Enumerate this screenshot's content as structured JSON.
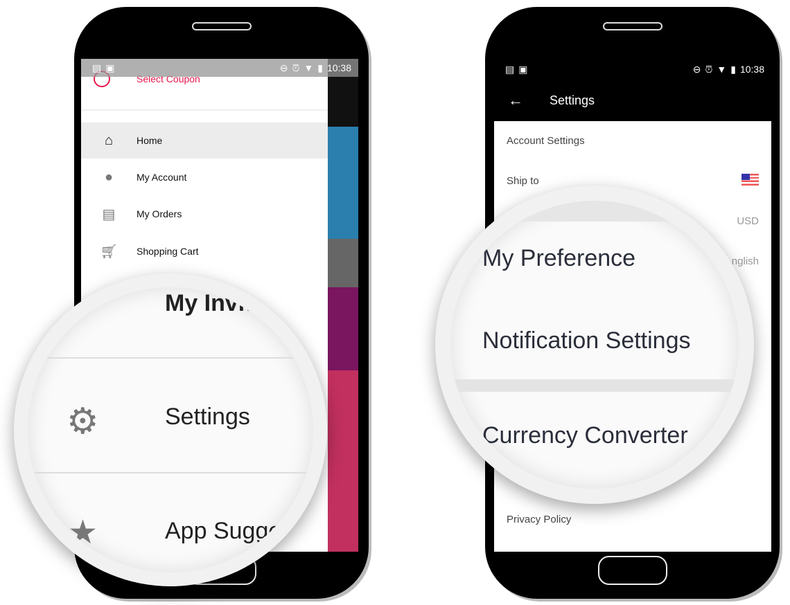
{
  "left_phone": {
    "status_time": "10:38",
    "drawer": {
      "coupon_label": "Select Coupon",
      "items": [
        {
          "label": "Home",
          "icon": "home-icon",
          "active": true
        },
        {
          "label": "My Account",
          "icon": "account-icon"
        },
        {
          "label": "My Orders",
          "icon": "clipboard-icon"
        },
        {
          "label": "Shopping Cart",
          "icon": "cart-icon"
        }
      ]
    },
    "magnifier": {
      "items": [
        {
          "label": "My Invit",
          "icon": "person-icon"
        },
        {
          "label": "Settings",
          "icon": "gear-icon"
        },
        {
          "label": "App Sugge",
          "icon": "star-icon"
        }
      ]
    }
  },
  "right_phone": {
    "status_time": "10:38",
    "toolbar_title": "Settings",
    "rows": [
      {
        "label": "Account Settings"
      },
      {
        "label": "Ship to",
        "value_icon": "us-flag-icon"
      },
      {
        "value": "USD"
      },
      {
        "value": "nglish"
      },
      {
        "label": "Privacy Policy"
      }
    ],
    "magnifier": {
      "items": [
        "My Preference",
        "Notification Settings",
        "Currency Converter"
      ]
    }
  },
  "colors": {
    "accent": "#e8174b",
    "toolbar": "#000000",
    "highlight": "#ececec"
  }
}
